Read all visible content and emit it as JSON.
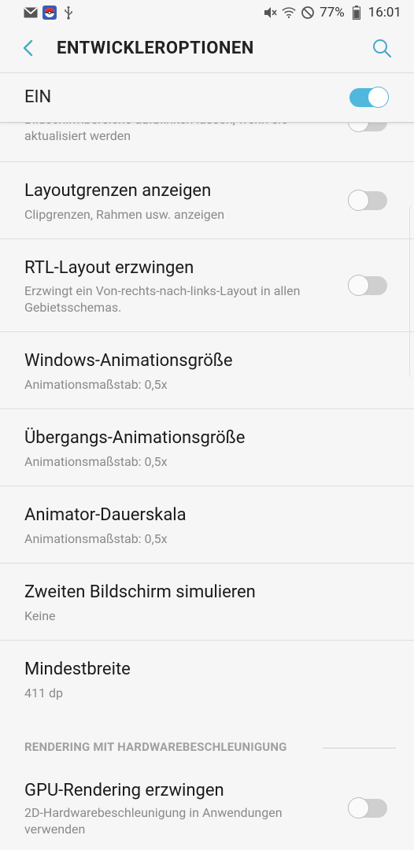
{
  "status_bar": {
    "battery_percent": "77%",
    "time": "16:01",
    "left_icons": [
      "gmail-icon",
      "pokeball-icon",
      "usb-icon"
    ],
    "right_icons": [
      "mute-icon",
      "wifi-icon",
      "do-not-disturb-icon",
      "battery-icon"
    ]
  },
  "app_bar": {
    "title": "ENTWICKLEROPTIONEN"
  },
  "master_switch": {
    "label": "EIN",
    "on": true
  },
  "partial_item": {
    "subtitle": "Bildschirmbereiche aufblinken lassen, wenn sie aktualisiert werden"
  },
  "items": [
    {
      "title": "Layoutgrenzen anzeigen",
      "subtitle": "Clipgrenzen, Rahmen usw. anzeigen",
      "toggle": false
    },
    {
      "title": "RTL-Layout erzwingen",
      "subtitle": "Erzwingt ein Von-rechts-nach-links-Layout in allen Gebietsschemas.",
      "toggle": false
    },
    {
      "title": "Windows-Animationsgröße",
      "subtitle": "Animationsmaßstab: 0,5x"
    },
    {
      "title": "Übergangs-Animationsgröße",
      "subtitle": "Animationsmaßstab: 0,5x"
    },
    {
      "title": "Animator-Dauerskala",
      "subtitle": "Animationsmaßstab: 0,5x"
    },
    {
      "title": "Zweiten Bildschirm simulieren",
      "subtitle": "Keine"
    },
    {
      "title": "Mindestbreite",
      "subtitle": "411 dp"
    }
  ],
  "section": {
    "header": "RENDERING MIT HARDWAREBESCHLEUNIGUNG"
  },
  "section_items": [
    {
      "title": "GPU-Rendering erzwingen",
      "subtitle": "2D-Hardwarebeschleunigung in Anwendungen verwenden",
      "toggle": false
    }
  ],
  "colors": {
    "accent": "#4fb8dc",
    "background": "#f6f6f6",
    "secondary_text": "#8a8a8a",
    "section_header": "#a0a0a0"
  }
}
